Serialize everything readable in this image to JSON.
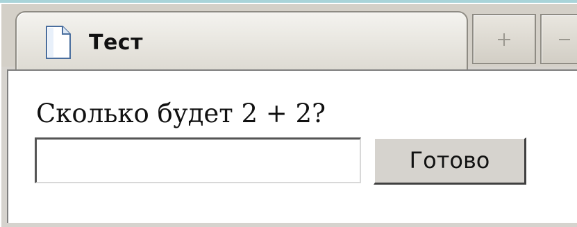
{
  "window": {
    "tab_title": "Тест",
    "tab_icon": "document-icon",
    "new_tab_icon": "plus-icon",
    "menu_icon": "minus-icon"
  },
  "form": {
    "question": "Сколько будет 2 + 2?",
    "answer_value": "",
    "submit_label": "Готово"
  }
}
